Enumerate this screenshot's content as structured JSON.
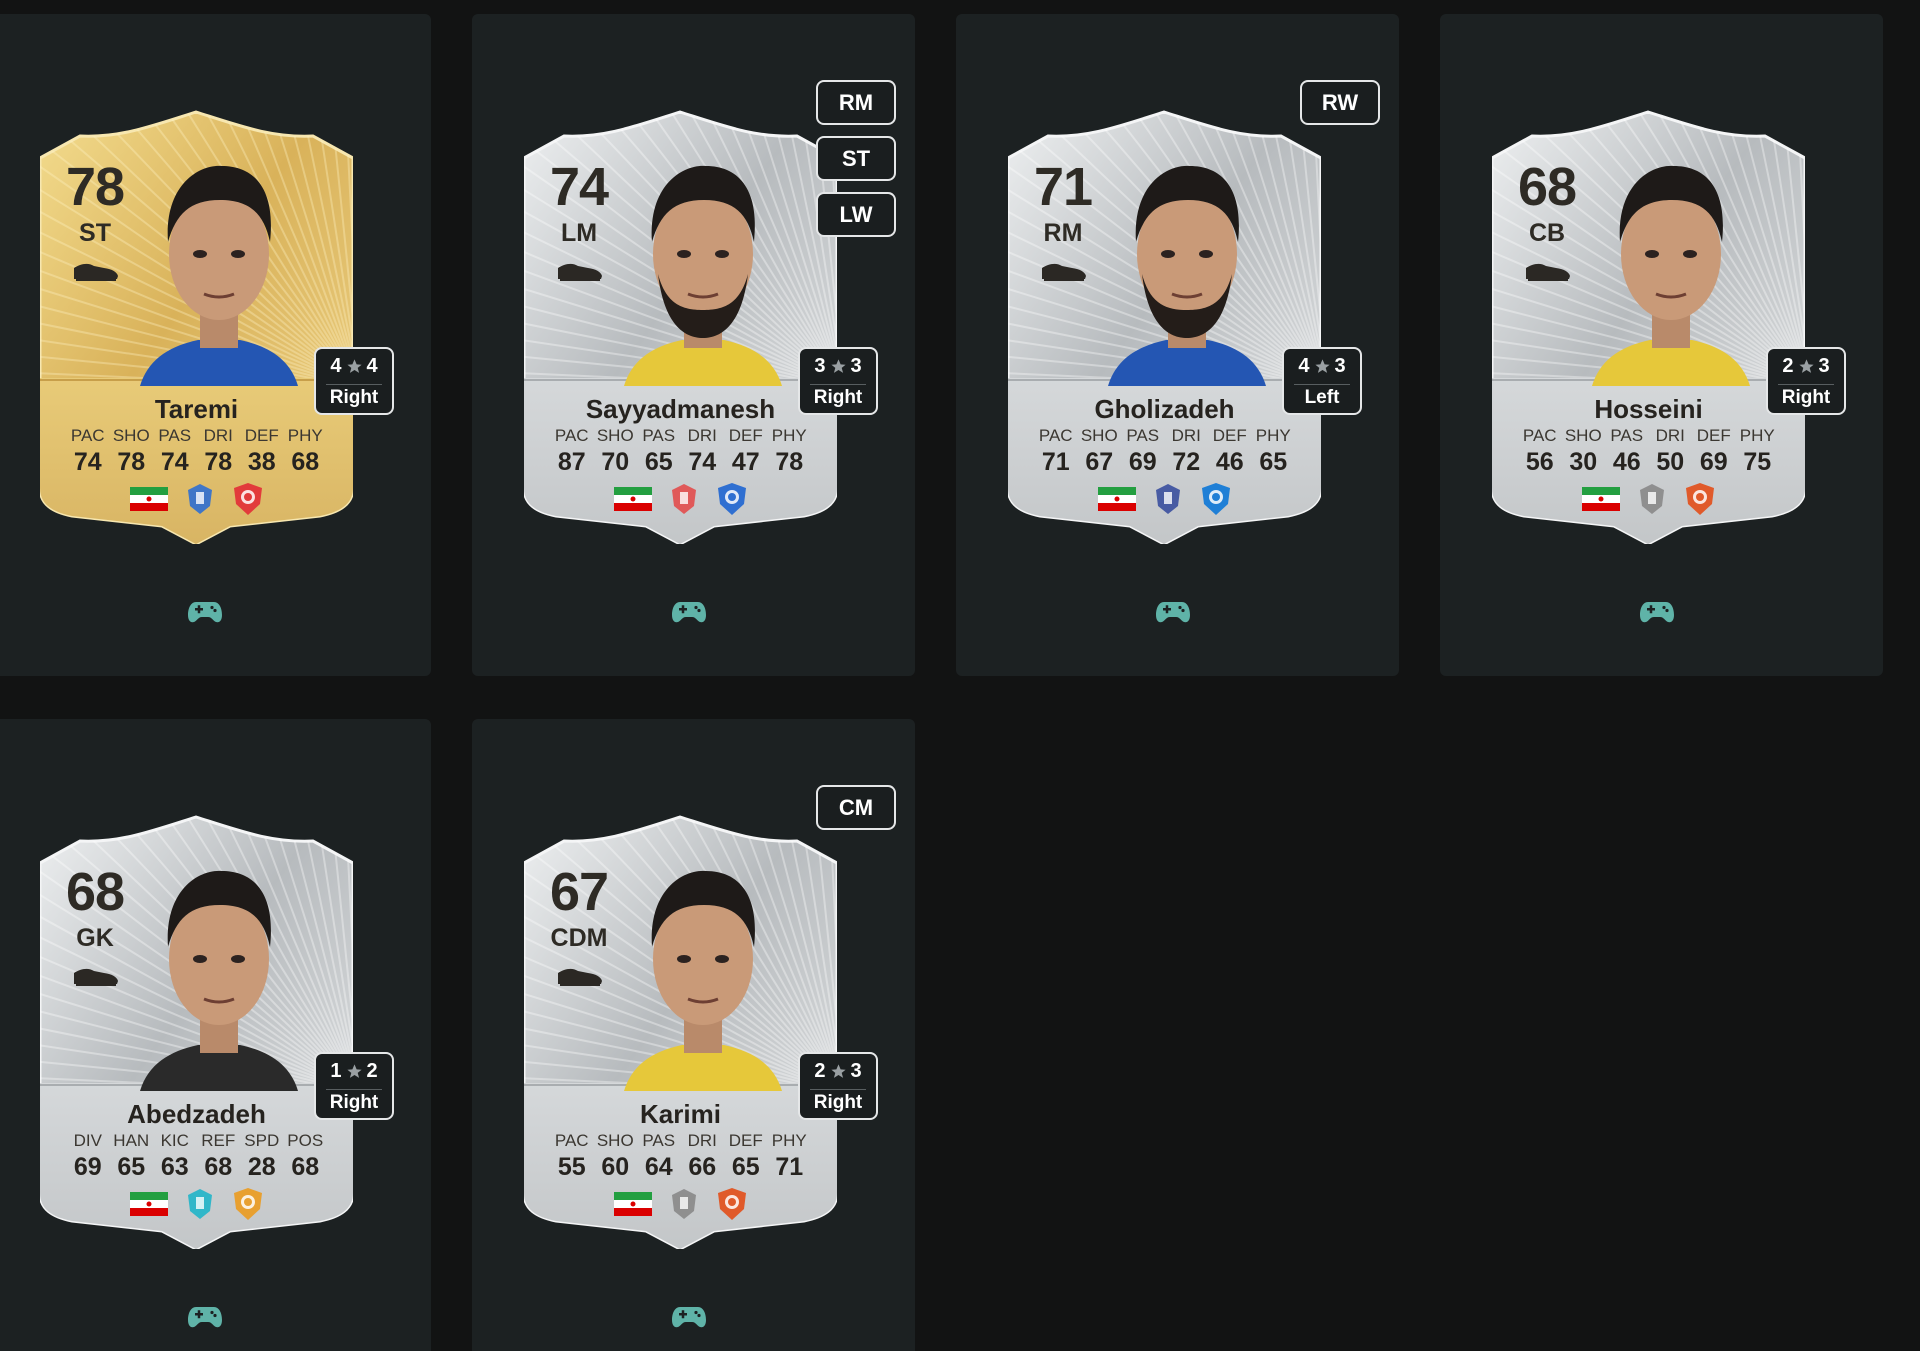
{
  "theme": {
    "gold": "#e2c46a",
    "silver": "#c8cbcd",
    "pad_color": "#5fb3a8",
    "panel_bg": "#1c2122",
    "page_bg": "#121313"
  },
  "cards": [
    {
      "variant": "gold",
      "rating": "78",
      "position": "ST",
      "name": "Taremi",
      "alt_positions": [],
      "skill_moves": "4",
      "weak_foot": "4",
      "preferred_foot": "Right",
      "stat_labels": [
        "PAC",
        "SHO",
        "PAS",
        "DRI",
        "DEF",
        "PHY"
      ],
      "stat_values": [
        "74",
        "78",
        "74",
        "78",
        "38",
        "68"
      ],
      "badges": [
        "iran-flag-icon",
        "league-badge-icon",
        "club-crest-icon"
      ],
      "icons": [
        "boot-icon",
        "gamepad-icon"
      ]
    },
    {
      "variant": "silver",
      "rating": "74",
      "position": "LM",
      "name": "Sayyadmanesh",
      "alt_positions": [
        "RM",
        "ST",
        "LW"
      ],
      "skill_moves": "3",
      "weak_foot": "3",
      "preferred_foot": "Right",
      "stat_labels": [
        "PAC",
        "SHO",
        "PAS",
        "DRI",
        "DEF",
        "PHY"
      ],
      "stat_values": [
        "87",
        "70",
        "65",
        "74",
        "47",
        "78"
      ],
      "badges": [
        "iran-flag-icon",
        "league-badge-icon",
        "club-crest-icon"
      ],
      "icons": [
        "boot-icon",
        "gamepad-icon"
      ]
    },
    {
      "variant": "silver",
      "rating": "71",
      "position": "RM",
      "name": "Gholizadeh",
      "alt_positions": [
        "RW"
      ],
      "skill_moves": "4",
      "weak_foot": "3",
      "preferred_foot": "Left",
      "stat_labels": [
        "PAC",
        "SHO",
        "PAS",
        "DRI",
        "DEF",
        "PHY"
      ],
      "stat_values": [
        "71",
        "67",
        "69",
        "72",
        "46",
        "65"
      ],
      "badges": [
        "iran-flag-icon",
        "league-badge-icon",
        "club-crest-icon"
      ],
      "icons": [
        "boot-icon",
        "gamepad-icon"
      ]
    },
    {
      "variant": "silver",
      "rating": "68",
      "position": "CB",
      "name": "Hosseini",
      "alt_positions": [],
      "skill_moves": "2",
      "weak_foot": "3",
      "preferred_foot": "Right",
      "stat_labels": [
        "PAC",
        "SHO",
        "PAS",
        "DRI",
        "DEF",
        "PHY"
      ],
      "stat_values": [
        "56",
        "30",
        "46",
        "50",
        "69",
        "75"
      ],
      "badges": [
        "iran-flag-icon",
        "league-badge-icon",
        "club-crest-icon"
      ],
      "icons": [
        "boot-icon",
        "gamepad-icon"
      ]
    },
    {
      "variant": "silver",
      "rating": "68",
      "position": "GK",
      "name": "Abedzadeh",
      "alt_positions": [],
      "skill_moves": "1",
      "weak_foot": "2",
      "preferred_foot": "Right",
      "stat_labels": [
        "DIV",
        "HAN",
        "KIC",
        "REF",
        "SPD",
        "POS"
      ],
      "stat_values": [
        "69",
        "65",
        "63",
        "68",
        "28",
        "68"
      ],
      "badges": [
        "iran-flag-icon",
        "league-badge-icon",
        "club-crest-icon"
      ],
      "icons": [
        "boot-icon",
        "gamepad-icon"
      ]
    },
    {
      "variant": "silver",
      "rating": "67",
      "position": "CDM",
      "name": "Karimi",
      "alt_positions": [
        "CM"
      ],
      "skill_moves": "2",
      "weak_foot": "3",
      "preferred_foot": "Right",
      "stat_labels": [
        "PAC",
        "SHO",
        "PAS",
        "DRI",
        "DEF",
        "PHY"
      ],
      "stat_values": [
        "55",
        "60",
        "64",
        "66",
        "65",
        "71"
      ],
      "badges": [
        "iran-flag-icon",
        "league-badge-icon",
        "club-crest-icon"
      ],
      "icons": [
        "boot-icon",
        "gamepad-icon"
      ]
    }
  ]
}
